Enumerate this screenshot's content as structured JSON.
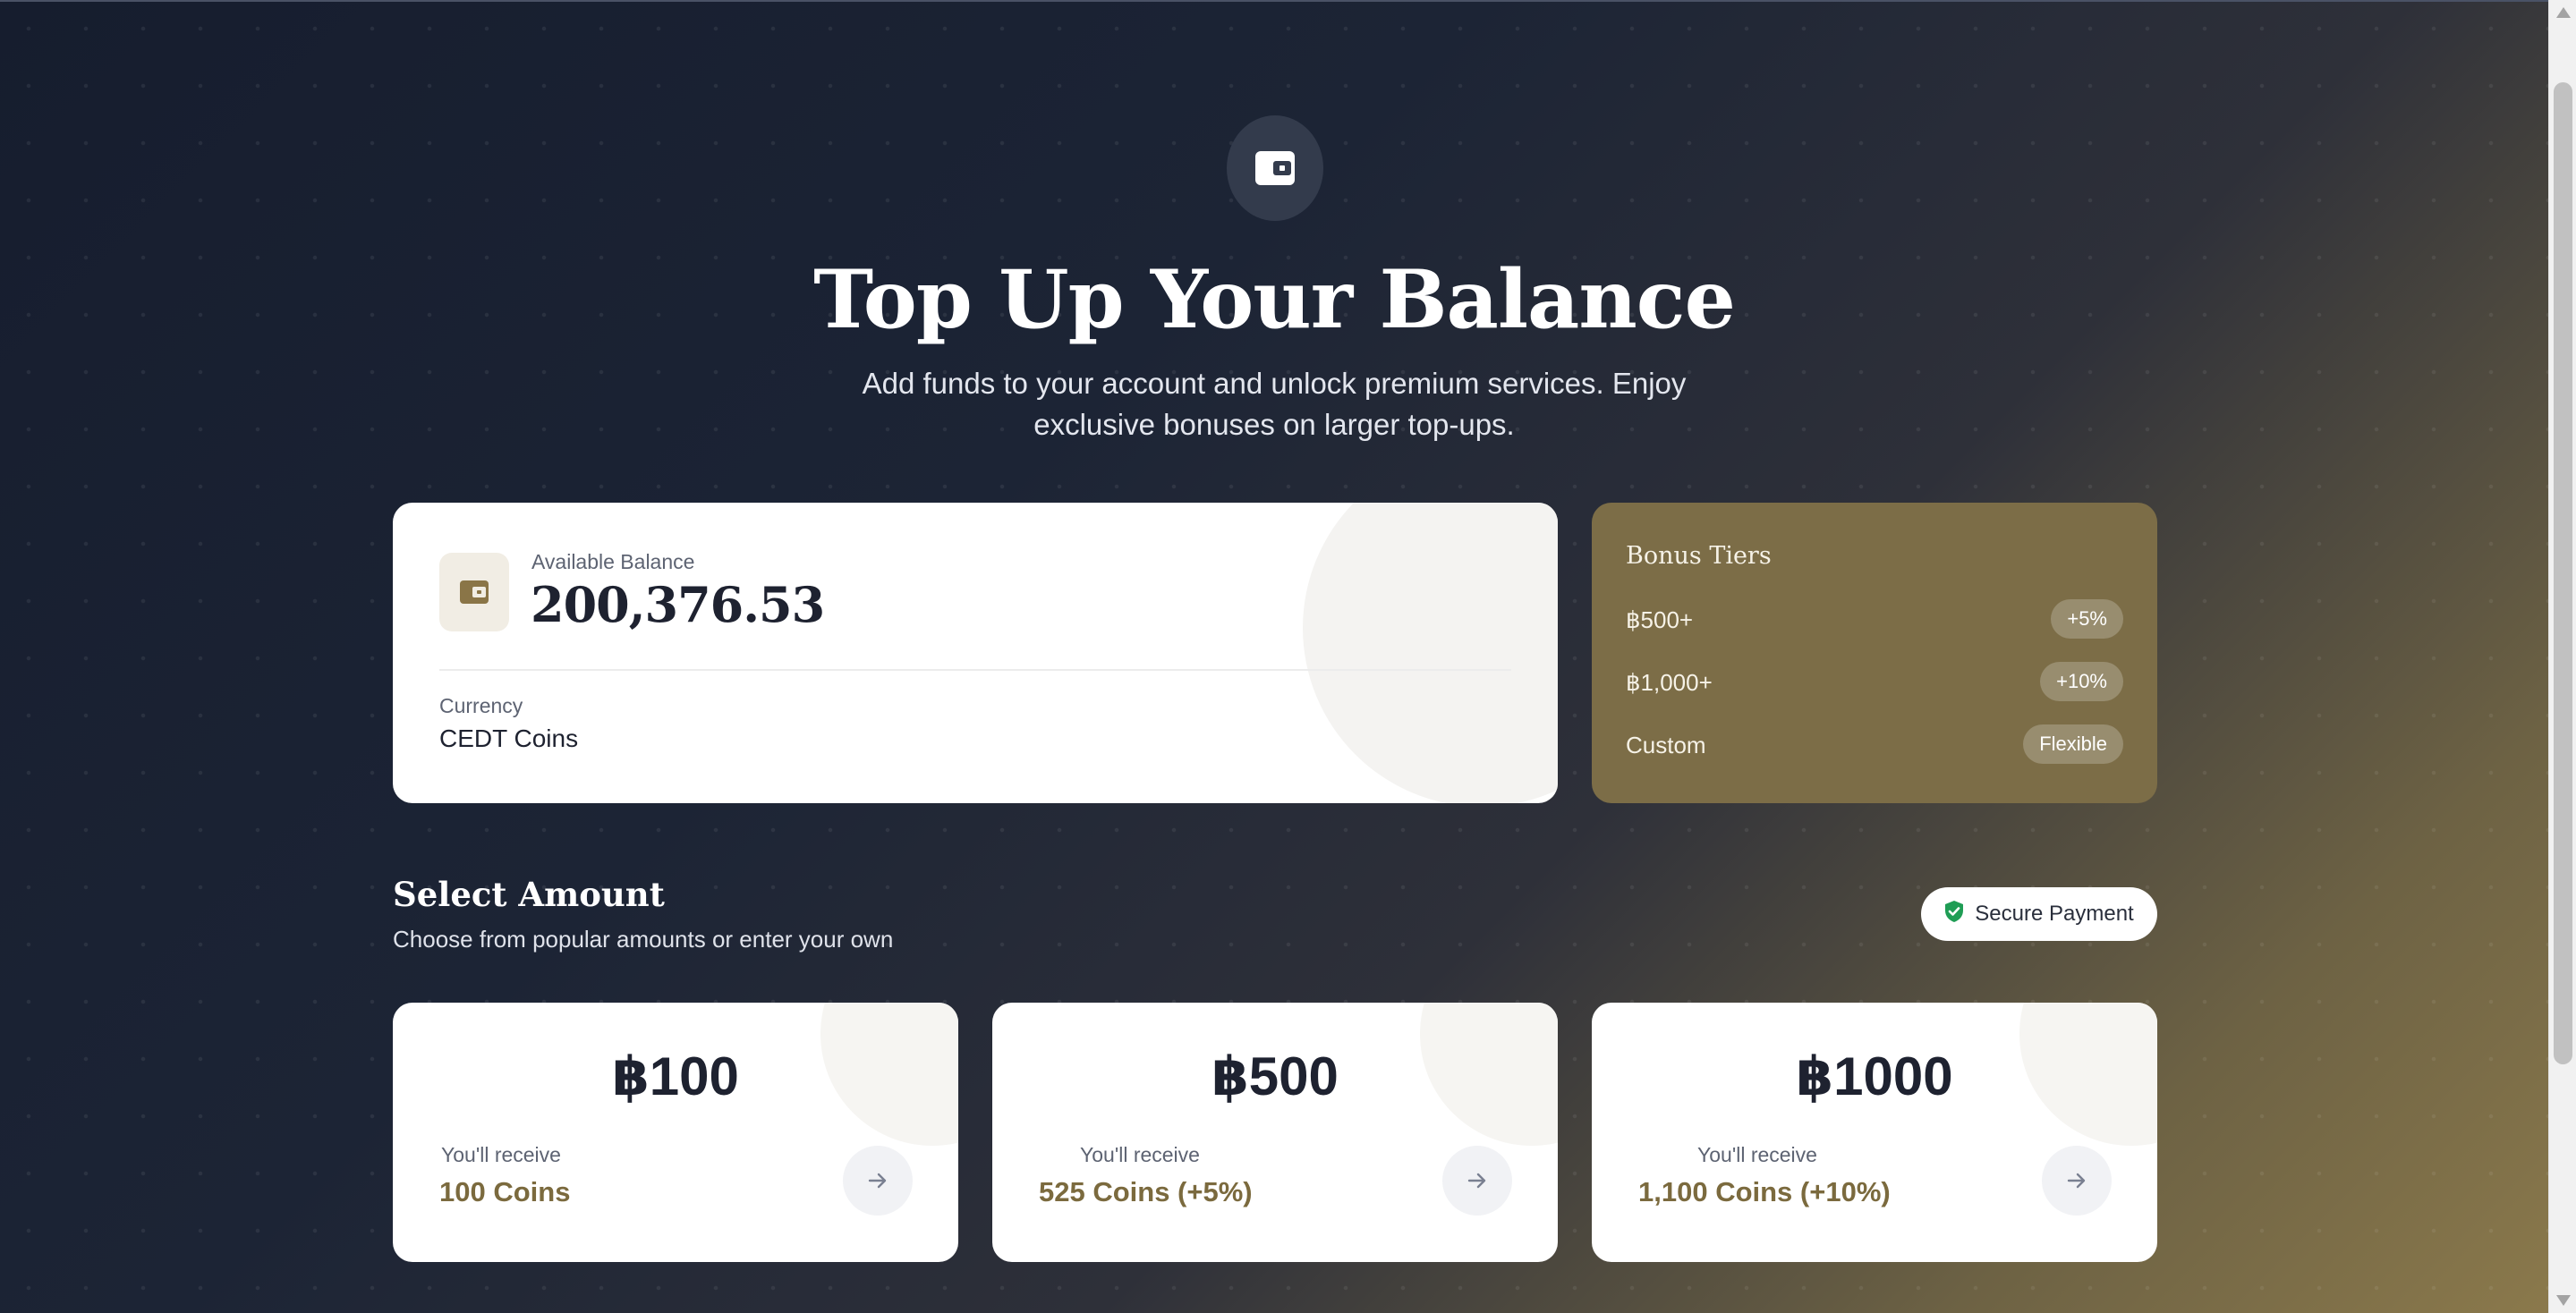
{
  "hero": {
    "title": "Top Up Your Balance",
    "subtitle": "Add funds to your account and unlock premium services. Enjoy exclusive bonuses on larger top-ups.",
    "icon": "wallet-icon"
  },
  "balance": {
    "label": "Available Balance",
    "value": "200,376.53",
    "currency_label": "Currency",
    "currency_value": "CEDT Coins",
    "icon": "wallet-icon"
  },
  "bonus": {
    "title": "Bonus Tiers",
    "tiers": [
      {
        "label": "฿500+",
        "badge": "+5%"
      },
      {
        "label": "฿1,000+",
        "badge": "+10%"
      },
      {
        "label": "Custom",
        "badge": "Flexible"
      }
    ]
  },
  "select": {
    "title": "Select Amount",
    "subtitle": "Choose from popular amounts or enter your own",
    "secure_label": "Secure Payment",
    "secure_icon": "shield-check-icon"
  },
  "amounts": [
    {
      "amount": "฿100",
      "receive_label": "You'll receive",
      "receive_value": "100 Coins"
    },
    {
      "amount": "฿500",
      "receive_label": "You'll receive",
      "receive_value": "525 Coins (+5%)"
    },
    {
      "amount": "฿1000",
      "receive_label": "You'll receive",
      "receive_value": "1,100 Coins (+10%)"
    }
  ],
  "colors": {
    "accent_gold": "#7b6a3e",
    "bonus_card": "#7c6d47",
    "background_dark": "#161d2e",
    "secure_green": "#1f9d55"
  }
}
